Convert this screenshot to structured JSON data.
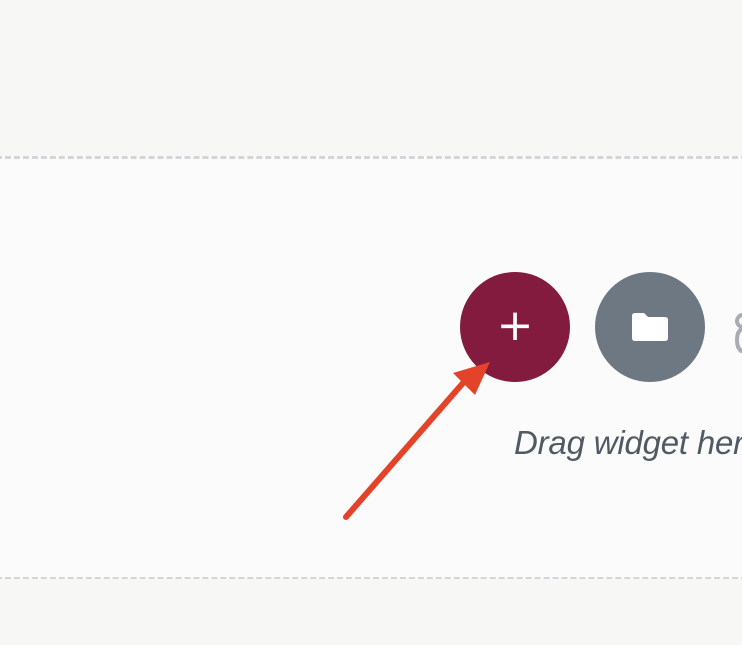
{
  "buttons": {
    "add_glyph": "+",
    "add_color": "#821b3e",
    "template_color": "#6d7882",
    "template_icon": "folder-icon"
  },
  "drop_zone": {
    "text": "Drag widget here"
  },
  "annotation": {
    "arrow_color": "#e34329"
  }
}
